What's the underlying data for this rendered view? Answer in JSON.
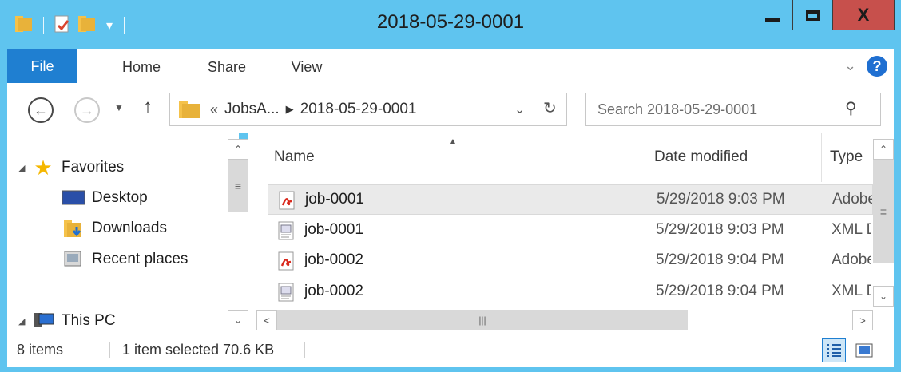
{
  "window": {
    "title": "2018-05-29-0001"
  },
  "ribbon": {
    "file": "File",
    "home": "Home",
    "share": "Share",
    "view": "View",
    "help": "?"
  },
  "address": {
    "overflow": "«",
    "crumb1": "JobsA...",
    "separator": "▶",
    "crumb2": "2018-05-29-0001"
  },
  "search": {
    "placeholder": "Search 2018-05-29-0001"
  },
  "nav": {
    "favorites": "Favorites",
    "desktop": "Desktop",
    "downloads": "Downloads",
    "recent": "Recent places",
    "this_pc": "This PC"
  },
  "columns": {
    "name": "Name",
    "date": "Date modified",
    "type": "Type"
  },
  "files": [
    {
      "name": "job-0001",
      "date": "5/29/2018 9:03 PM",
      "type": "Adobe Acrobat Document",
      "icon": "pdf-icon",
      "selected": true
    },
    {
      "name": "job-0001",
      "date": "5/29/2018 9:03 PM",
      "type": "XML Document",
      "icon": "xml-icon",
      "selected": false
    },
    {
      "name": "job-0002",
      "date": "5/29/2018 9:04 PM",
      "type": "Adobe Acrobat Document",
      "icon": "pdf-icon",
      "selected": false
    },
    {
      "name": "job-0002",
      "date": "5/29/2018 9:04 PM",
      "type": "XML Document",
      "icon": "xml-icon",
      "selected": false
    }
  ],
  "status": {
    "count": "8 items",
    "selection": "1 item selected  70.6 KB"
  },
  "colors": {
    "title_bar": "#5fc4ef",
    "file_tab": "#1f7fd1",
    "close_button": "#c7504c",
    "selection": "#eaeaea"
  }
}
